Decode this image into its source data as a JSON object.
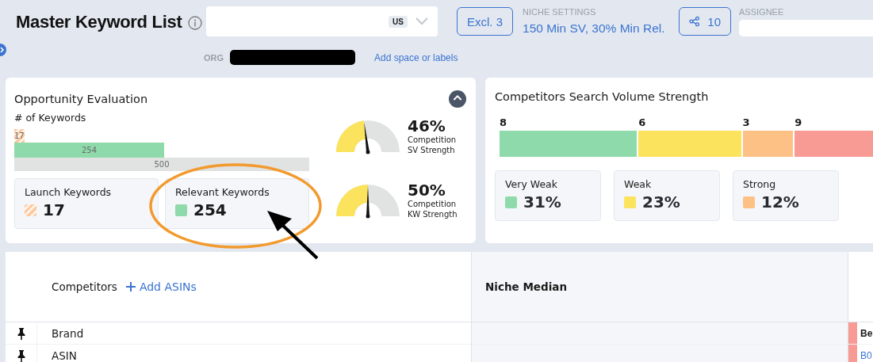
{
  "header": {
    "title": "Master Keyword List",
    "marketplace": {
      "badge": "US"
    },
    "org": {
      "label": "ORG"
    },
    "add_labels_link": "Add space or labels",
    "exclusions_button": "Excl. 3",
    "niche_settings": {
      "label": "NICHE SETTINGS",
      "value": "150 Min SV, 30% Min Rel."
    },
    "share_button": "10",
    "assignee": {
      "label": "ASSIGNEE"
    }
  },
  "opportunity": {
    "title": "Opportunity Evaluation",
    "expanded": true,
    "subtitle": "# of Keywords",
    "bars": [
      {
        "kind": "launch",
        "value": "17"
      },
      {
        "kind": "relevant",
        "value": "254"
      },
      {
        "kind": "total",
        "value": "500"
      }
    ],
    "stats": [
      {
        "kind": "launch",
        "label": "Launch Keywords",
        "value": "17"
      },
      {
        "kind": "relevant",
        "label": "Relevant Keywords",
        "value": "254"
      }
    ],
    "gauges": [
      {
        "reading": "46%",
        "caption": "Competition SV Strength"
      },
      {
        "reading": "50%",
        "caption": "Competition KW Strength"
      }
    ]
  },
  "competitors_strength": {
    "title": "Competitors Search Volume Strength",
    "segments": [
      {
        "value": "8",
        "color": "#8fdaab"
      },
      {
        "value": "6",
        "color": "#fbe35e"
      },
      {
        "value": "3",
        "color": "#fdc185"
      },
      {
        "value": "9",
        "color": "#f89b94"
      }
    ],
    "legend": [
      {
        "label": "Very Weak",
        "value": "31%",
        "color": "#8fdaab"
      },
      {
        "label": "Weak",
        "value": "23%",
        "color": "#fbe35e"
      },
      {
        "label": "Strong",
        "value": "12%",
        "color": "#fdc185"
      }
    ]
  },
  "table": {
    "columns": [
      {
        "title": "Competitors",
        "action": "Add ASINs"
      },
      {
        "title": "Niche Median"
      }
    ],
    "rows": [
      {
        "label": "Brand",
        "pinned": true,
        "column_3": "Be"
      },
      {
        "label": "ASIN",
        "pinned": true,
        "column_3": "B0"
      }
    ]
  },
  "annotations": [
    {
      "kind": "ellipse"
    },
    {
      "kind": "arrow"
    }
  ]
}
